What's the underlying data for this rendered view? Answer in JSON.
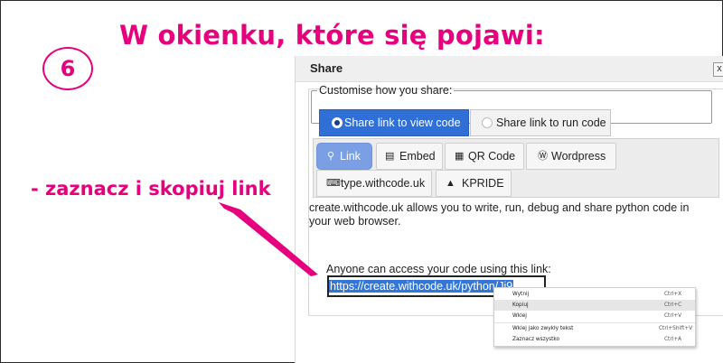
{
  "annotation": {
    "step": "6",
    "heading": "W okienku, które się pojawi:",
    "instruction": "- zaznacz i skopiuj link",
    "accent_color": "#e6007e"
  },
  "dialog": {
    "title": "Share",
    "close_label": "x",
    "customise_legend": "Customise how you share:",
    "radios": [
      {
        "label": "Share link to view code",
        "selected": true
      },
      {
        "label": "Share link to run code",
        "selected": false
      }
    ],
    "tabs": [
      {
        "label": "Link",
        "icon": "link-icon",
        "active": true
      },
      {
        "label": "Embed",
        "icon": "embed-icon",
        "active": false
      },
      {
        "label": "QR Code",
        "icon": "qr-icon",
        "active": false
      },
      {
        "label": "Wordpress",
        "icon": "wordpress-icon",
        "active": false
      },
      {
        "label": "type.withcode.uk",
        "icon": "keyboard-icon",
        "active": false
      },
      {
        "label": "KPRIDE",
        "icon": "graduation-cap-icon",
        "active": false
      }
    ],
    "description": "create.withcode.uk allows you to write, run, debug and share python code in your web browser.",
    "access_label": "Anyone can access your code using this link:",
    "link_value": "https://create.withcode.uk/python/Jj9",
    "accent_color": "#2f6fd6"
  },
  "context_menu": {
    "items": [
      {
        "label": "Wytnij",
        "shortcut": "Ctrl+X"
      },
      {
        "label": "Kopiuj",
        "shortcut": "Ctrl+C",
        "highlighted": true
      },
      {
        "label": "Wklej",
        "shortcut": "Ctrl+V"
      },
      {
        "label": "Wklej jako zwykły tekst",
        "shortcut": "Ctrl+Shift+V"
      },
      {
        "label": "Zaznacz wszystko",
        "shortcut": "Ctrl+A"
      }
    ]
  }
}
